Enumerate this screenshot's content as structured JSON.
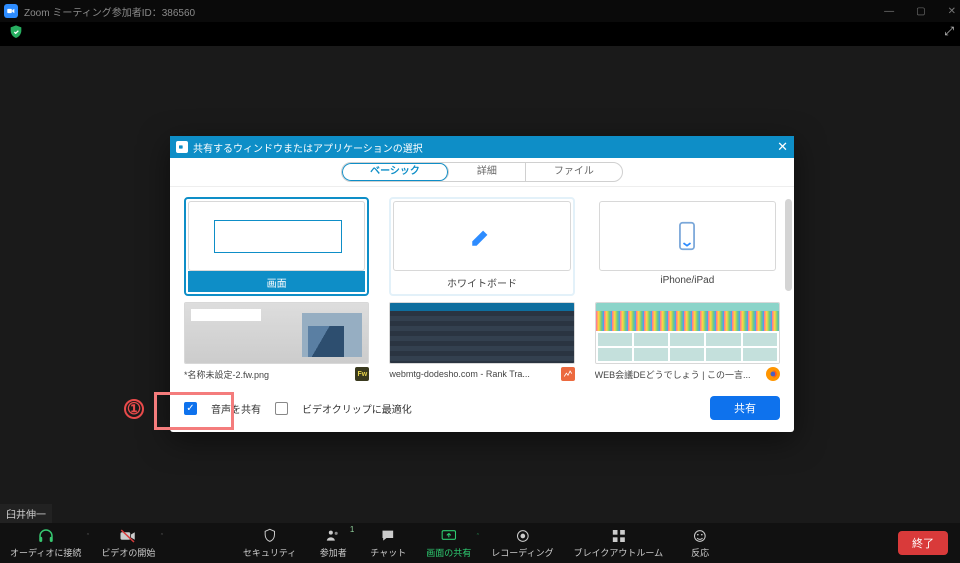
{
  "window": {
    "title": "Zoom ミーティング参加者ID：386560"
  },
  "dialog": {
    "title": "共有するウィンドウまたはアプリケーションの選択",
    "tabs": {
      "basic": "ベーシック",
      "advanced": "詳細",
      "file": "ファイル"
    },
    "tiles": {
      "screen": "画面",
      "whiteboard": "ホワイトボード",
      "iphone": "iPhone/iPad",
      "app1": "*名称未設定-2.fw.png",
      "app2": "webmtg-dodesho.com - Rank Tra...",
      "app3": "WEB会議DEどうでしょう | この一言..."
    },
    "footer": {
      "shareAudio": "音声を共有",
      "optimizeVideo": "ビデオクリップに最適化",
      "shareBtn": "共有"
    }
  },
  "annotation": {
    "num": "①"
  },
  "username": "臼井伸一",
  "toolbar": {
    "audio": "オーディオに接続",
    "video": "ビデオの開始",
    "security": "セキュリティ",
    "participants": "参加者",
    "participantsCount": "1",
    "chat": "チャット",
    "share": "画面の共有",
    "record": "レコーディング",
    "breakout": "ブレイクアウトルーム",
    "reactions": "反応",
    "end": "終了"
  }
}
